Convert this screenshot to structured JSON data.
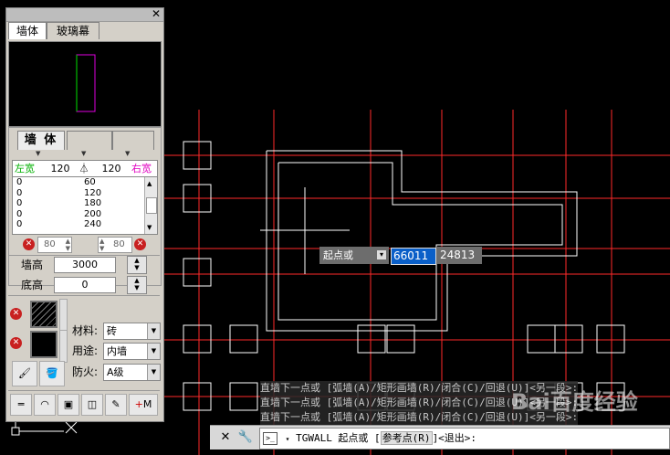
{
  "palette": {
    "tabs": [
      "墙体",
      "玻璃幕"
    ],
    "subtabs": [
      "墙 体",
      "",
      ""
    ],
    "left_width_label": "左宽",
    "left_width": "120",
    "right_width": "120",
    "right_width_label": "右宽",
    "width_list": [
      [
        "0",
        "60"
      ],
      [
        "0",
        "120"
      ],
      [
        "0",
        "180"
      ],
      [
        "0",
        "200"
      ],
      [
        "0",
        "240"
      ]
    ],
    "offset_left": "80",
    "offset_right": "80",
    "wall_height_label": "墙高",
    "wall_height": "3000",
    "base_height_label": "底高",
    "base_height": "0",
    "material_label": "材料:",
    "material": "砖",
    "usage_label": "用途:",
    "usage": "内墙",
    "fire_label": "防火:",
    "fire": "A级",
    "colors": {
      "left_width_text": "#00b000",
      "right_width_text": "#e000c0"
    }
  },
  "tooltip": {
    "prompt": "起点或",
    "x_value": "66011",
    "y_value": "24813"
  },
  "history": [
    "直墙下一点或 [弧墙(A)/矩形画墙(R)/闭合(C)/回退(U)]<另一段>:",
    "直墙下一点或 [弧墙(A)/矩形画墙(R)/闭合(C)/回退(U)]<另一段>:",
    "直墙下一点或 [弧墙(A)/矩形画墙(R)/闭合(C)/回退(U)]<另一段>:"
  ],
  "command": {
    "prefix": "TGWALL 起点或 [",
    "keyword": "参考点(R)",
    "suffix": "]<退出>:"
  },
  "watermark": "Bai百度经验",
  "canvas": {
    "background": "#000000",
    "axis_color": "#ff2020",
    "wall_color": "#ffffff"
  }
}
